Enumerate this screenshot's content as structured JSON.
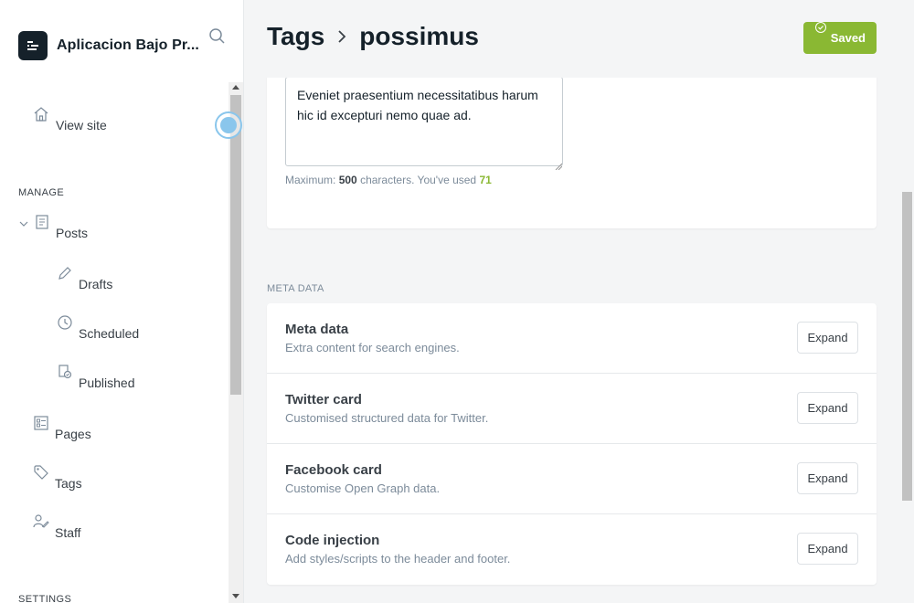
{
  "brand": {
    "name": "Aplicacion Bajo Pr..."
  },
  "sidebar": {
    "view_site": "View site",
    "manage_label": "MANAGE",
    "items": [
      {
        "label": "Posts",
        "icon": "posts-icon"
      },
      {
        "label": "Drafts",
        "icon": "pencil-icon"
      },
      {
        "label": "Scheduled",
        "icon": "clock-icon"
      },
      {
        "label": "Published",
        "icon": "published-icon"
      },
      {
        "label": "Pages",
        "icon": "pages-icon"
      },
      {
        "label": "Tags",
        "icon": "tag-icon"
      },
      {
        "label": "Staff",
        "icon": "staff-icon"
      }
    ],
    "settings_label": "SETTINGS"
  },
  "header": {
    "crumb_parent": "Tags",
    "crumb_sep": ">",
    "crumb_current": "possimus",
    "saved_label": "Saved"
  },
  "description": {
    "value": "Eveniet praesentium necessitatibus harum hic id excepturi nemo quae ad.",
    "hint_prefix": "Maximum:",
    "max": "500",
    "hint_middle": "characters. You've used",
    "used": "71"
  },
  "meta": {
    "section_label": "META DATA",
    "rows": [
      {
        "title": "Meta data",
        "desc": "Extra content for search engines.",
        "button": "Expand"
      },
      {
        "title": "Twitter card",
        "desc": "Customised structured data for Twitter.",
        "button": "Expand"
      },
      {
        "title": "Facebook card",
        "desc": "Customise Open Graph data.",
        "button": "Expand"
      },
      {
        "title": "Code injection",
        "desc": "Add styles/scripts to the header and footer.",
        "button": "Expand"
      }
    ]
  },
  "colors": {
    "accent": "#8ab833",
    "text": "#15212a",
    "muted": "#7c8b9a"
  }
}
